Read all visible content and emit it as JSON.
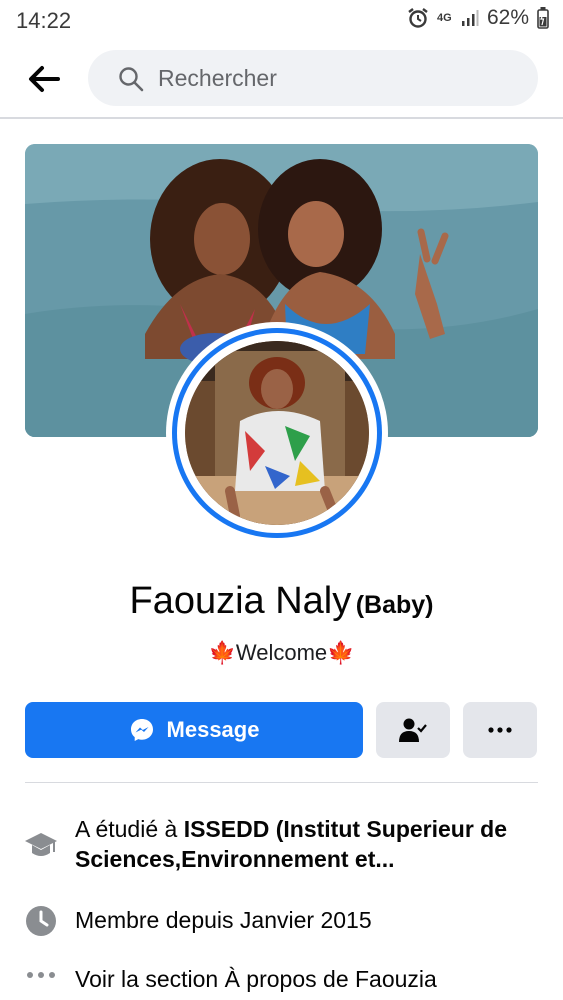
{
  "status_bar": {
    "time": "14:22",
    "network": "4G",
    "battery": "62%"
  },
  "search": {
    "placeholder": "Rechercher"
  },
  "profile": {
    "name": "Faouzia Naly",
    "nickname": "(Baby)",
    "bio_leaf_left": "🍁",
    "bio_text": "Welcome",
    "bio_leaf_right": "🍁"
  },
  "actions": {
    "message_label": "Message"
  },
  "info": {
    "education_prefix": "A étudié à ",
    "education_school": "ISSEDD (Institut Superieur de Sciences,Environnement et...",
    "member_since": "Membre depuis Janvier 2015",
    "about_link": "Voir la section À propos de Faouzia"
  },
  "colors": {
    "accent": "#1877f2",
    "secondary_button": "#e4e6eb",
    "search_bg": "#f0f2f5"
  },
  "icons": [
    "back-arrow-icon",
    "search-icon",
    "messenger-icon",
    "friends-icon",
    "more-icon",
    "graduation-cap-icon",
    "clock-icon",
    "dots-icon",
    "alarm-icon",
    "signal-icon",
    "battery-icon"
  ]
}
